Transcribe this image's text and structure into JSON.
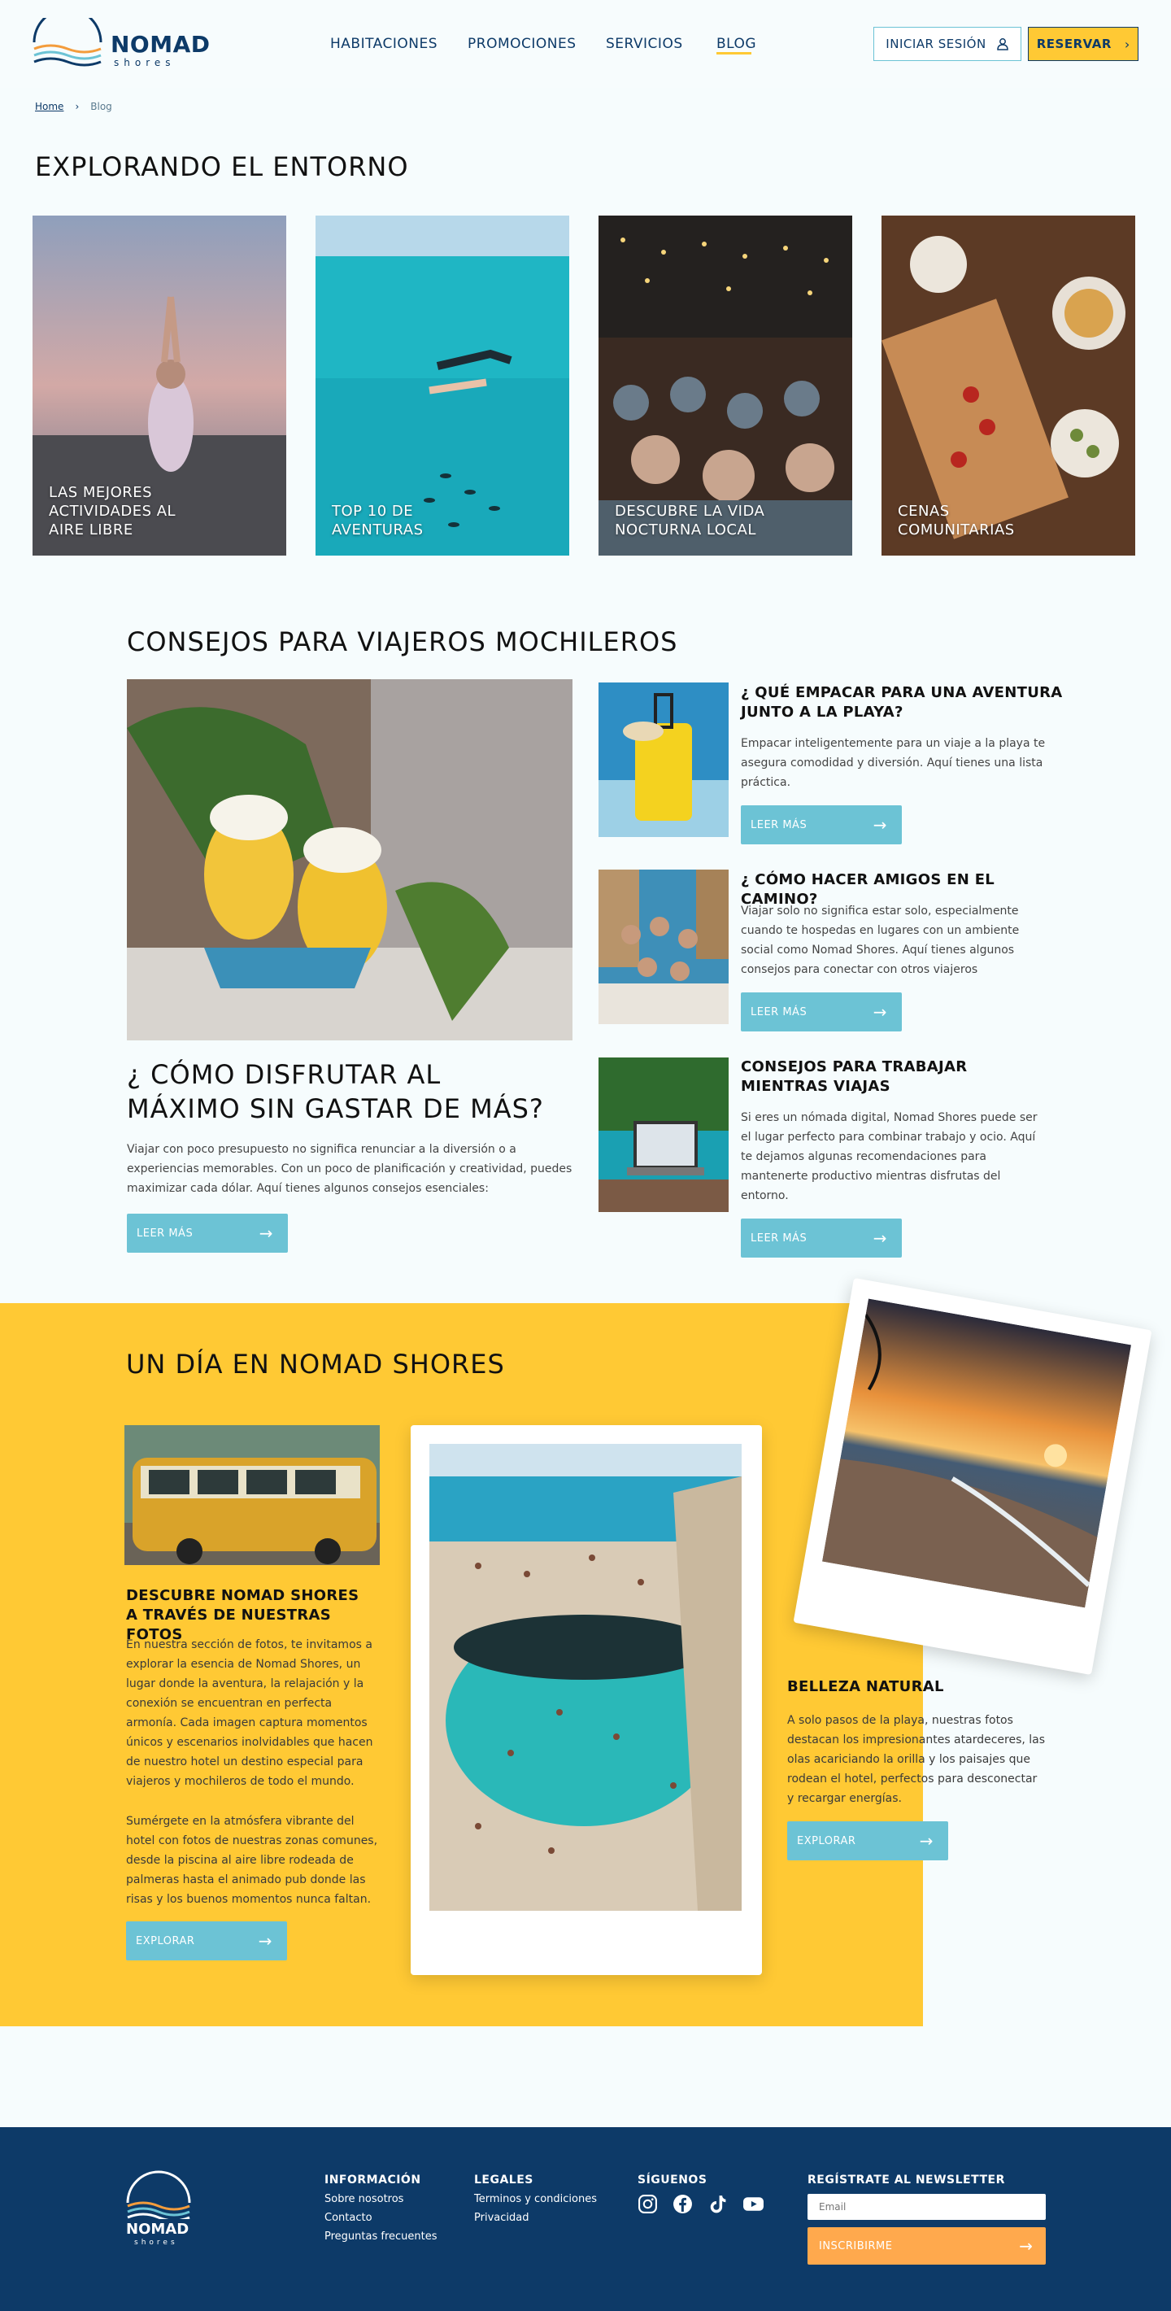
{
  "header": {
    "brand": {
      "name": "NOMAD",
      "sub": "shores"
    },
    "nav": [
      {
        "label": "HABITACIONES"
      },
      {
        "label": "PROMOCIONES"
      },
      {
        "label": "SERVICIOS"
      },
      {
        "label": "BLOG"
      }
    ],
    "login_label": "INICIAR SESIÓN",
    "reserve_label": "RESERVAR"
  },
  "breadcrumb": {
    "home": "Home",
    "current": "Blog"
  },
  "explore": {
    "title": "EXPLORANDO EL ENTORNO",
    "cards": [
      {
        "caption": "LAS MEJORES ACTIVIDADES AL AIRE LIBRE"
      },
      {
        "caption": "TOP 10 DE AVENTURAS"
      },
      {
        "caption": "DESCUBRE LA VIDA NOCTURNA LOCAL"
      },
      {
        "caption": "CENAS COMUNITARIAS"
      }
    ]
  },
  "tips": {
    "title": "CONSEJOS PARA VIAJEROS MOCHILEROS",
    "featured": {
      "title": "¿ CÓMO DISFRUTAR AL MÁXIMO SIN GASTAR DE MÁS?",
      "text": "Viajar con poco presupuesto no significa renunciar a la diversión o a experiencias memorables. Con un poco de planificación y creatividad, puedes maximizar cada dólar. Aquí tienes algunos consejos esenciales:",
      "button": "LEER MÁS"
    },
    "items": [
      {
        "title": "¿ QUÉ EMPACAR PARA UNA AVENTURA JUNTO A LA PLAYA?",
        "text": "Empacar inteligentemente para un viaje a la playa te asegura comodidad y diversión. Aquí tienes una lista práctica.",
        "button": "LEER MÁS"
      },
      {
        "title": "¿ CÓMO HACER AMIGOS EN EL CAMINO?",
        "text": "Viajar solo no significa estar solo, especialmente cuando te hospedas en lugares con un ambiente social como Nomad Shores. Aquí tienes algunos consejos para conectar con otros viajeros",
        "button": "LEER MÁS"
      },
      {
        "title": "CONSEJOS PARA TRABAJAR MIENTRAS VIAJAS",
        "text": "Si eres un nómada digital, Nomad Shores puede ser el lugar perfecto para combinar trabajo y ocio. Aquí te dejamos algunas recomendaciones para mantenerte productivo mientras disfrutas del entorno.",
        "button": "LEER MÁS"
      }
    ]
  },
  "day": {
    "title": "UN DÍA EN NOMAD SHORES",
    "photos": {
      "title": "DESCUBRE NOMAD SHORES A TRAVÉS DE NUESTRAS FOTOS",
      "p1": "En nuestra sección de fotos, te invitamos a explorar la esencia de Nomad Shores, un lugar donde la aventura, la relajación y la conexión se encuentran en perfecta armonía. Cada imagen captura momentos únicos y escenarios inolvidables que hacen de nuestro hotel un destino especial para viajeros y mochileros de todo el mundo.",
      "p2": "Sumérgete en la atmósfera vibrante del hotel con fotos de nuestras zonas comunes, desde la piscina al aire libre rodeada de palmeras hasta el animado pub donde las risas y los buenos momentos nunca faltan.",
      "button": "EXPLORAR"
    },
    "nature": {
      "title": "BELLEZA NATURAL",
      "text": "A solo pasos de la playa, nuestras fotos destacan los impresionantes atardeceres, las olas acariciando la orilla y los paisajes que rodean el hotel, perfectos para desconectar y recargar energías.",
      "button": "EXPLORAR"
    }
  },
  "footer": {
    "brand": {
      "name": "NOMAD",
      "sub": "shores"
    },
    "info": {
      "title": "INFORMACIÓN",
      "links": [
        "Sobre nosotros",
        "Contacto",
        "Preguntas frecuentes"
      ]
    },
    "legal": {
      "title": "LEGALES",
      "links": [
        "Terminos y condiciones",
        "Privacidad"
      ]
    },
    "social": {
      "title": "SÍGUENOS",
      "icons": [
        "instagram-icon",
        "facebook-icon",
        "tiktok-icon",
        "youtube-icon"
      ]
    },
    "newsletter": {
      "title": "REGÍSTRATE AL NEWSLETTER",
      "placeholder": "Email",
      "button": "INSCRIBIRME"
    }
  },
  "colors": {
    "navy": "#0d3a68",
    "accent": "#ffc934",
    "teal": "#6cc3d5",
    "orange": "#ffa94d"
  }
}
